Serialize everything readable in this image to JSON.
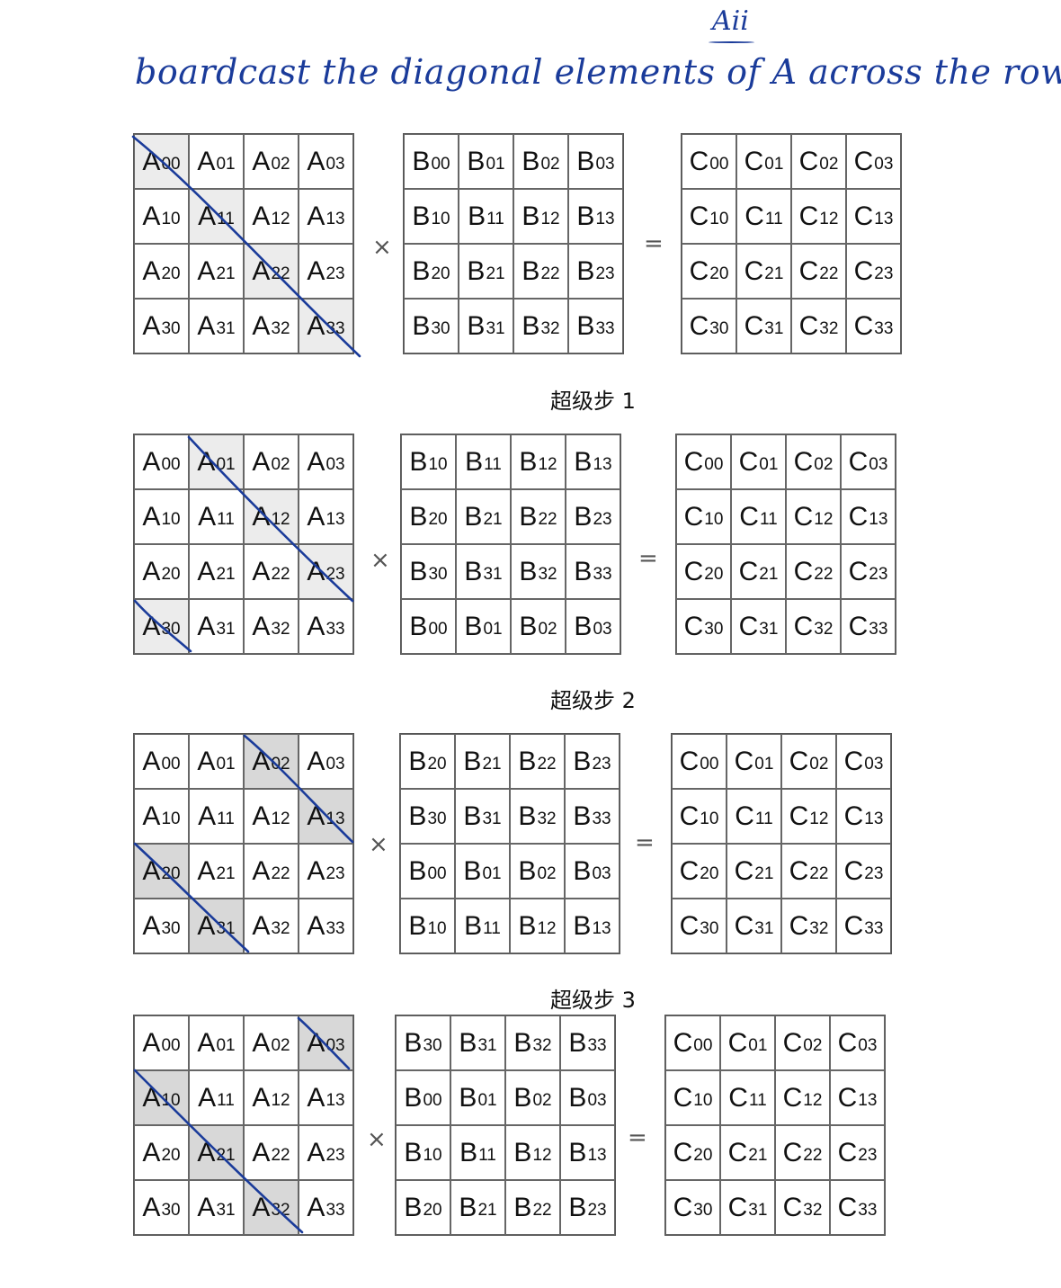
{
  "annotation": {
    "text": "boardcast the diagonal elements of A across the rows.",
    "note": "Aii"
  },
  "operators": {
    "times": "×",
    "equals": "="
  },
  "blocks": [
    {
      "label": "",
      "A": [
        [
          "A",
          "00"
        ],
        [
          "A",
          "01"
        ],
        [
          "A",
          "02"
        ],
        [
          "A",
          "03"
        ],
        [
          "A",
          "10"
        ],
        [
          "A",
          "11"
        ],
        [
          "A",
          "12"
        ],
        [
          "A",
          "13"
        ],
        [
          "A",
          "20"
        ],
        [
          "A",
          "21"
        ],
        [
          "A",
          "22"
        ],
        [
          "A",
          "23"
        ],
        [
          "A",
          "30"
        ],
        [
          "A",
          "31"
        ],
        [
          "A",
          "32"
        ],
        [
          "A",
          "33"
        ]
      ],
      "A_shaded": [
        0,
        5,
        10,
        15
      ],
      "B": [
        [
          "B",
          "00"
        ],
        [
          "B",
          "01"
        ],
        [
          "B",
          "02"
        ],
        [
          "B",
          "03"
        ],
        [
          "B",
          "10"
        ],
        [
          "B",
          "11"
        ],
        [
          "B",
          "12"
        ],
        [
          "B",
          "13"
        ],
        [
          "B",
          "20"
        ],
        [
          "B",
          "21"
        ],
        [
          "B",
          "22"
        ],
        [
          "B",
          "23"
        ],
        [
          "B",
          "30"
        ],
        [
          "B",
          "31"
        ],
        [
          "B",
          "32"
        ],
        [
          "B",
          "33"
        ]
      ],
      "C": [
        [
          "C",
          "00"
        ],
        [
          "C",
          "01"
        ],
        [
          "C",
          "02"
        ],
        [
          "C",
          "03"
        ],
        [
          "C",
          "10"
        ],
        [
          "C",
          "11"
        ],
        [
          "C",
          "12"
        ],
        [
          "C",
          "13"
        ],
        [
          "C",
          "20"
        ],
        [
          "C",
          "21"
        ],
        [
          "C",
          "22"
        ],
        [
          "C",
          "23"
        ],
        [
          "C",
          "30"
        ],
        [
          "C",
          "31"
        ],
        [
          "C",
          "32"
        ],
        [
          "C",
          "33"
        ]
      ]
    },
    {
      "label": "超级步 1",
      "A": [
        [
          "A",
          "00"
        ],
        [
          "A",
          "01"
        ],
        [
          "A",
          "02"
        ],
        [
          "A",
          "03"
        ],
        [
          "A",
          "10"
        ],
        [
          "A",
          "11"
        ],
        [
          "A",
          "12"
        ],
        [
          "A",
          "13"
        ],
        [
          "A",
          "20"
        ],
        [
          "A",
          "21"
        ],
        [
          "A",
          "22"
        ],
        [
          "A",
          "23"
        ],
        [
          "A",
          "30"
        ],
        [
          "A",
          "31"
        ],
        [
          "A",
          "32"
        ],
        [
          "A",
          "33"
        ]
      ],
      "A_shaded": [
        1,
        6,
        11,
        12
      ],
      "B": [
        [
          "B",
          "10"
        ],
        [
          "B",
          "11"
        ],
        [
          "B",
          "12"
        ],
        [
          "B",
          "13"
        ],
        [
          "B",
          "20"
        ],
        [
          "B",
          "21"
        ],
        [
          "B",
          "22"
        ],
        [
          "B",
          "23"
        ],
        [
          "B",
          "30"
        ],
        [
          "B",
          "31"
        ],
        [
          "B",
          "32"
        ],
        [
          "B",
          "33"
        ],
        [
          "B",
          "00"
        ],
        [
          "B",
          "01"
        ],
        [
          "B",
          "02"
        ],
        [
          "B",
          "03"
        ]
      ],
      "C": [
        [
          "C",
          "00"
        ],
        [
          "C",
          "01"
        ],
        [
          "C",
          "02"
        ],
        [
          "C",
          "03"
        ],
        [
          "C",
          "10"
        ],
        [
          "C",
          "11"
        ],
        [
          "C",
          "12"
        ],
        [
          "C",
          "13"
        ],
        [
          "C",
          "20"
        ],
        [
          "C",
          "21"
        ],
        [
          "C",
          "22"
        ],
        [
          "C",
          "23"
        ],
        [
          "C",
          "30"
        ],
        [
          "C",
          "31"
        ],
        [
          "C",
          "32"
        ],
        [
          "C",
          "33"
        ]
      ]
    },
    {
      "label": "超级步 2",
      "A": [
        [
          "A",
          "00"
        ],
        [
          "A",
          "01"
        ],
        [
          "A",
          "02"
        ],
        [
          "A",
          "03"
        ],
        [
          "A",
          "10"
        ],
        [
          "A",
          "11"
        ],
        [
          "A",
          "12"
        ],
        [
          "A",
          "13"
        ],
        [
          "A",
          "20"
        ],
        [
          "A",
          "21"
        ],
        [
          "A",
          "22"
        ],
        [
          "A",
          "23"
        ],
        [
          "A",
          "30"
        ],
        [
          "A",
          "31"
        ],
        [
          "A",
          "32"
        ],
        [
          "A",
          "33"
        ]
      ],
      "A_shaded": [
        2,
        7,
        8,
        13
      ],
      "B": [
        [
          "B",
          "20"
        ],
        [
          "B",
          "21"
        ],
        [
          "B",
          "22"
        ],
        [
          "B",
          "23"
        ],
        [
          "B",
          "30"
        ],
        [
          "B",
          "31"
        ],
        [
          "B",
          "32"
        ],
        [
          "B",
          "33"
        ],
        [
          "B",
          "00"
        ],
        [
          "B",
          "01"
        ],
        [
          "B",
          "02"
        ],
        [
          "B",
          "03"
        ],
        [
          "B",
          "10"
        ],
        [
          "B",
          "11"
        ],
        [
          "B",
          "12"
        ],
        [
          "B",
          "13"
        ]
      ],
      "C": [
        [
          "C",
          "00"
        ],
        [
          "C",
          "01"
        ],
        [
          "C",
          "02"
        ],
        [
          "C",
          "03"
        ],
        [
          "C",
          "10"
        ],
        [
          "C",
          "11"
        ],
        [
          "C",
          "12"
        ],
        [
          "C",
          "13"
        ],
        [
          "C",
          "20"
        ],
        [
          "C",
          "21"
        ],
        [
          "C",
          "22"
        ],
        [
          "C",
          "23"
        ],
        [
          "C",
          "30"
        ],
        [
          "C",
          "31"
        ],
        [
          "C",
          "32"
        ],
        [
          "C",
          "33"
        ]
      ]
    },
    {
      "label": "超级步 3",
      "A": [
        [
          "A",
          "00"
        ],
        [
          "A",
          "01"
        ],
        [
          "A",
          "02"
        ],
        [
          "A",
          "03"
        ],
        [
          "A",
          "10"
        ],
        [
          "A",
          "11"
        ],
        [
          "A",
          "12"
        ],
        [
          "A",
          "13"
        ],
        [
          "A",
          "20"
        ],
        [
          "A",
          "21"
        ],
        [
          "A",
          "22"
        ],
        [
          "A",
          "23"
        ],
        [
          "A",
          "30"
        ],
        [
          "A",
          "31"
        ],
        [
          "A",
          "32"
        ],
        [
          "A",
          "33"
        ]
      ],
      "A_shaded": [
        3,
        4,
        9,
        14
      ],
      "B": [
        [
          "B",
          "30"
        ],
        [
          "B",
          "31"
        ],
        [
          "B",
          "32"
        ],
        [
          "B",
          "33"
        ],
        [
          "B",
          "00"
        ],
        [
          "B",
          "01"
        ],
        [
          "B",
          "02"
        ],
        [
          "B",
          "03"
        ],
        [
          "B",
          "10"
        ],
        [
          "B",
          "11"
        ],
        [
          "B",
          "12"
        ],
        [
          "B",
          "13"
        ],
        [
          "B",
          "20"
        ],
        [
          "B",
          "21"
        ],
        [
          "B",
          "22"
        ],
        [
          "B",
          "23"
        ]
      ],
      "C": [
        [
          "C",
          "00"
        ],
        [
          "C",
          "01"
        ],
        [
          "C",
          "02"
        ],
        [
          "C",
          "03"
        ],
        [
          "C",
          "10"
        ],
        [
          "C",
          "11"
        ],
        [
          "C",
          "12"
        ],
        [
          "C",
          "13"
        ],
        [
          "C",
          "20"
        ],
        [
          "C",
          "21"
        ],
        [
          "C",
          "22"
        ],
        [
          "C",
          "23"
        ],
        [
          "C",
          "30"
        ],
        [
          "C",
          "31"
        ],
        [
          "C",
          "32"
        ],
        [
          "C",
          "33"
        ]
      ]
    }
  ],
  "colors": {
    "ink": "#1a3b9a",
    "shade": "#ececec",
    "shade_dark": "#d8d8d8"
  }
}
